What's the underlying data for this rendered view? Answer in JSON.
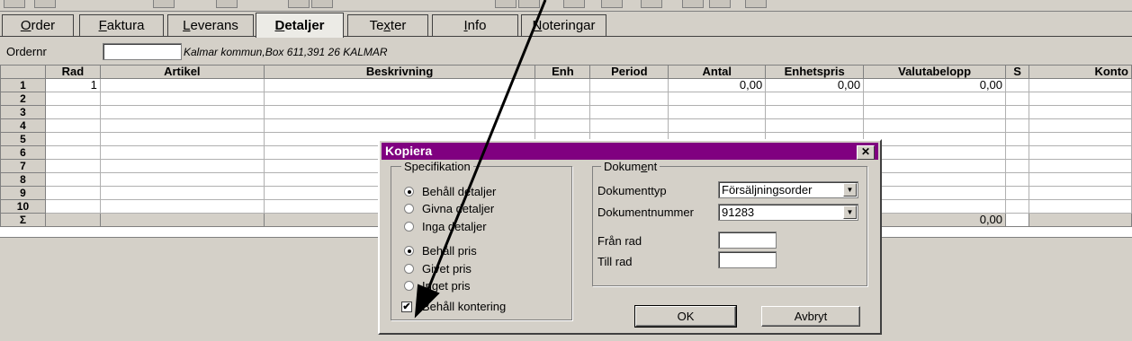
{
  "tabs": [
    {
      "label": "Order",
      "mn": "O",
      "rest": "rder"
    },
    {
      "label": "Faktura",
      "mn": "F",
      "rest": "aktura"
    },
    {
      "label": "Leverans",
      "mn": "L",
      "rest": "everans"
    },
    {
      "label": "Detaljer",
      "mn": "D",
      "rest": "etaljer"
    },
    {
      "label": "Texter",
      "pre": "Te",
      "mn": "x",
      "rest": "ter"
    },
    {
      "label": "Info",
      "mn": "I",
      "rest": "nfo"
    },
    {
      "label": "Noteringar",
      "mn": "N",
      "rest": "oteringar"
    }
  ],
  "header": {
    "ordernr_label": "Ordernr",
    "ordernr_value": "",
    "address": "Kalmar kommun,Box 611,391 26 KALMAR"
  },
  "grid": {
    "columns": [
      "Rad",
      "Artikel",
      "Beskrivning",
      "Enh",
      "Period",
      "Antal",
      "Enhetspris",
      "Valutabelopp",
      "S",
      "Konto"
    ],
    "rows": [
      {
        "n": "1",
        "rad": "1",
        "antal": "0,00",
        "enhetspris": "0,00",
        "valutabelopp": "0,00"
      },
      {
        "n": "2"
      },
      {
        "n": "3"
      },
      {
        "n": "4"
      },
      {
        "n": "5"
      },
      {
        "n": "6"
      },
      {
        "n": "7"
      },
      {
        "n": "8"
      },
      {
        "n": "9"
      },
      {
        "n": "10"
      }
    ],
    "sum_label": "Σ",
    "sum_valutabelopp": "0,00"
  },
  "dialog": {
    "title": "Kopiera",
    "close": "✕",
    "spec_legend": "Specifikation",
    "spec_options": [
      {
        "label": "Behåll detaljer",
        "selected": true
      },
      {
        "label": "Givna detaljer",
        "selected": false
      },
      {
        "label": "Inga detaljer",
        "selected": false
      }
    ],
    "price_options": [
      {
        "label": "Behåll pris",
        "selected": true
      },
      {
        "label": "Givet pris",
        "selected": false
      },
      {
        "label": "Inget pris",
        "selected": false
      }
    ],
    "keep_account_label": "Behåll kontering",
    "keep_account_checked": true,
    "doc_legend_pre": "Dokum",
    "doc_legend_mn": "e",
    "doc_legend_rest": "nt",
    "doctype_label": "Dokumenttyp",
    "doctype_value": "Försäljningsorder",
    "docnum_label": "Dokumentnummer",
    "docnum_value": "91283",
    "from_row_label": "Från rad",
    "from_row_value": "",
    "to_row_label": "Till rad",
    "to_row_value": "",
    "ok_label": "OK",
    "cancel_label": "Avbryt"
  },
  "colors": {
    "dialog_title_bg": "#800080",
    "window_bg": "#d4d0c8"
  }
}
